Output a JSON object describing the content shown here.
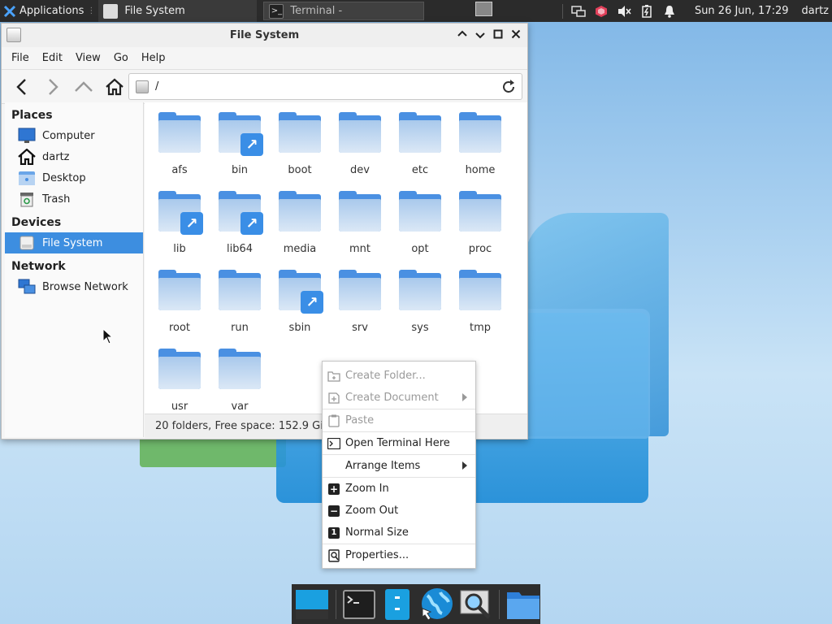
{
  "top_panel": {
    "applications_label": "Applications",
    "task_active": "File System",
    "task_terminal": "Terminal -",
    "clock": "Sun 26 Jun, 17:29",
    "user": "dartz"
  },
  "window": {
    "title": "File System",
    "menu": [
      "File",
      "Edit",
      "View",
      "Go",
      "Help"
    ],
    "address": "/"
  },
  "sidebar": {
    "places_header": "Places",
    "places": [
      "Computer",
      "dartz",
      "Desktop",
      "Trash"
    ],
    "devices_header": "Devices",
    "devices": [
      "File System"
    ],
    "network_header": "Network",
    "network": [
      "Browse Network"
    ]
  },
  "folders": [
    {
      "name": "afs",
      "link": false
    },
    {
      "name": "bin",
      "link": true
    },
    {
      "name": "boot",
      "link": false
    },
    {
      "name": "dev",
      "link": false
    },
    {
      "name": "etc",
      "link": false
    },
    {
      "name": "home",
      "link": false
    },
    {
      "name": "lib",
      "link": true
    },
    {
      "name": "lib64",
      "link": true
    },
    {
      "name": "media",
      "link": false
    },
    {
      "name": "mnt",
      "link": false
    },
    {
      "name": "opt",
      "link": false
    },
    {
      "name": "proc",
      "link": false
    },
    {
      "name": "root",
      "link": false
    },
    {
      "name": "run",
      "link": false
    },
    {
      "name": "sbin",
      "link": true
    },
    {
      "name": "srv",
      "link": false
    },
    {
      "name": "sys",
      "link": false
    },
    {
      "name": "tmp",
      "link": false
    },
    {
      "name": "usr",
      "link": false
    },
    {
      "name": "var",
      "link": false
    }
  ],
  "status": "20 folders, Free space: 152.9 GiB",
  "context_menu": {
    "create_folder": "Create Folder...",
    "create_document": "Create Document",
    "paste": "Paste",
    "open_terminal": "Open Terminal Here",
    "arrange_items": "Arrange Items",
    "zoom_in": "Zoom In",
    "zoom_out": "Zoom Out",
    "normal_size": "Normal Size",
    "properties": "Properties..."
  },
  "colors": {
    "accent": "#3d8ee0",
    "folder": "#4a90e2",
    "panel": "#2b2b2b"
  }
}
